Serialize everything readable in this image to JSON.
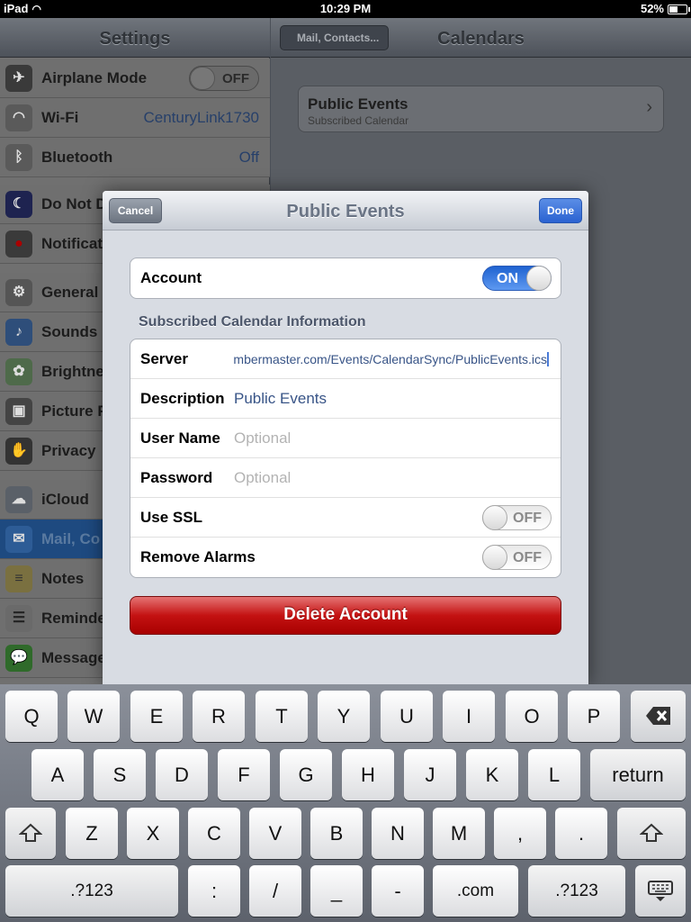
{
  "status": {
    "device": "iPad",
    "time": "10:29 PM",
    "battery": "52%",
    "battery_level": 0.52
  },
  "settings": {
    "title": "Settings",
    "rows": [
      {
        "label": "Airplane Mode",
        "icon": "airplane-icon",
        "switch": "OFF"
      },
      {
        "label": "Wi-Fi",
        "icon": "wifi-icon",
        "value": "CenturyLink1730"
      },
      {
        "label": "Bluetooth",
        "icon": "bluetooth-icon",
        "value": "Off"
      },
      {
        "label": "Do Not D",
        "icon": "moon-icon"
      },
      {
        "label": "Notificat",
        "icon": "notifications-icon"
      },
      {
        "label": "General",
        "icon": "gear-icon"
      },
      {
        "label": "Sounds",
        "icon": "speaker-icon"
      },
      {
        "label": "Brightne",
        "icon": "flower-icon"
      },
      {
        "label": "Picture F",
        "icon": "picture-frame-icon"
      },
      {
        "label": "Privacy",
        "icon": "hand-icon"
      },
      {
        "label": "iCloud",
        "icon": "cloud-icon"
      },
      {
        "label": "Mail, Co",
        "icon": "mail-icon"
      },
      {
        "label": "Notes",
        "icon": "notes-icon"
      },
      {
        "label": "Reminde",
        "icon": "reminders-icon"
      },
      {
        "label": "Message",
        "icon": "messages-icon"
      }
    ]
  },
  "detail": {
    "back_label": "Mail, Contacts...",
    "title": "Calendars",
    "card": {
      "title": "Public Events",
      "subtitle": "Subscribed Calendar"
    }
  },
  "modal": {
    "title": "Public Events",
    "cancel": "Cancel",
    "done": "Done",
    "account": {
      "label": "Account",
      "state": "ON"
    },
    "section": "Subscribed Calendar Information",
    "fields": {
      "server": {
        "label": "Server",
        "value": "mbermaster.com/Events/CalendarSync/PublicEvents.ics"
      },
      "description": {
        "label": "Description",
        "value": "Public Events"
      },
      "username": {
        "label": "User Name",
        "placeholder": "Optional"
      },
      "password": {
        "label": "Password",
        "placeholder": "Optional"
      },
      "ssl": {
        "label": "Use SSL",
        "state": "OFF"
      },
      "alarms": {
        "label": "Remove Alarms",
        "state": "OFF"
      }
    },
    "delete": "Delete Account"
  },
  "keyboard": {
    "row1": [
      "Q",
      "W",
      "E",
      "R",
      "T",
      "Y",
      "U",
      "I",
      "O",
      "P"
    ],
    "row2": [
      "A",
      "S",
      "D",
      "F",
      "G",
      "H",
      "J",
      "K",
      "L"
    ],
    "row2_return": "return",
    "row3": [
      "Z",
      "X",
      "C",
      "V",
      "B",
      "N",
      "M",
      ",",
      "."
    ],
    "row4": [
      ".?123",
      ":",
      "/",
      "_",
      "-",
      ".com",
      ".?123"
    ]
  }
}
